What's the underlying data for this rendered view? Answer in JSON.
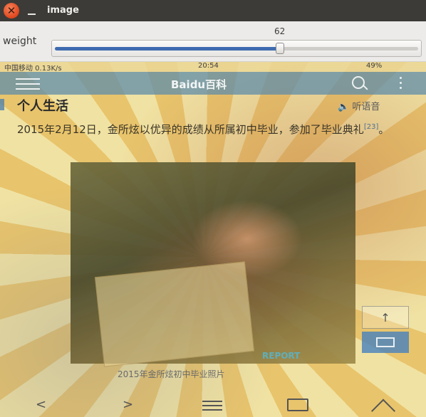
{
  "window": {
    "title": "image",
    "close_glyph": "✕",
    "minimize_glyph": "—"
  },
  "trackbar": {
    "label": "weight",
    "value": 62,
    "value_text": "62",
    "max": 100,
    "fill_color": "#3f6cb0"
  },
  "image": {
    "status_left": "中国移动 0.13K/s",
    "status_time": "20:54",
    "status_right": "49%",
    "brand": "Baidu百科",
    "section_title": "个人生活",
    "audio_link": "听语音",
    "paragraph_text": "2015年2月12日，金所炫以优异的成绩从所属初中毕业，参加了毕业典礼",
    "paragraph_ref": "[23]",
    "paragraph_end": "。",
    "watermark": "REPORT",
    "caption": "2015年金所炫初中毕业照片",
    "scroll_top_glyph": "↑",
    "nav_back_glyph": "<",
    "nav_forward_glyph": ">"
  }
}
